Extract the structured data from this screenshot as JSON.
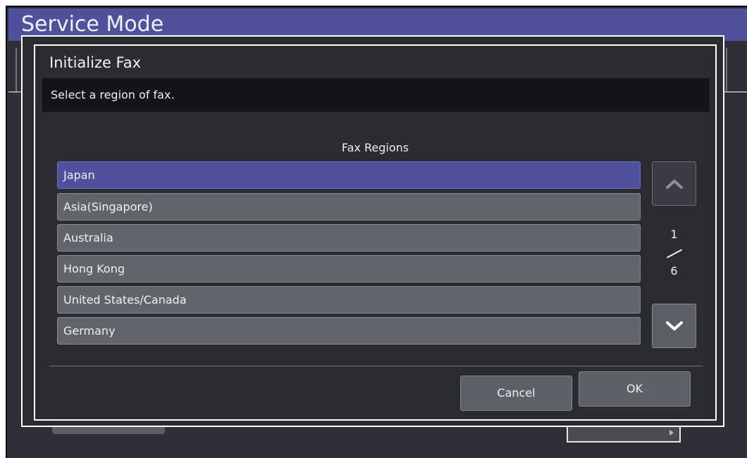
{
  "app": {
    "title": "Service Mode"
  },
  "dialog": {
    "title": "Initialize Fax",
    "message": "Select a region of fax.",
    "list_heading": "Fax Regions",
    "regions": [
      {
        "label": "Japan",
        "selected": true
      },
      {
        "label": "Asia(Singapore)",
        "selected": false
      },
      {
        "label": "Australia",
        "selected": false
      },
      {
        "label": "Hong Kong",
        "selected": false
      },
      {
        "label": "United States/Canada",
        "selected": false
      },
      {
        "label": "Germany",
        "selected": false
      }
    ],
    "pagination": {
      "current": "1",
      "total": "6"
    },
    "buttons": {
      "cancel_label": "Cancel",
      "ok_label": "OK"
    }
  },
  "icons": {
    "scroll_up": "chevron-up-icon",
    "scroll_down": "chevron-down-icon"
  },
  "colors": {
    "header_bg": "#4f519c",
    "dialog_bg": "#2b2c32",
    "selected_item": "#4f519e",
    "item_bg": "#62646b",
    "message_bar": "#141518"
  }
}
